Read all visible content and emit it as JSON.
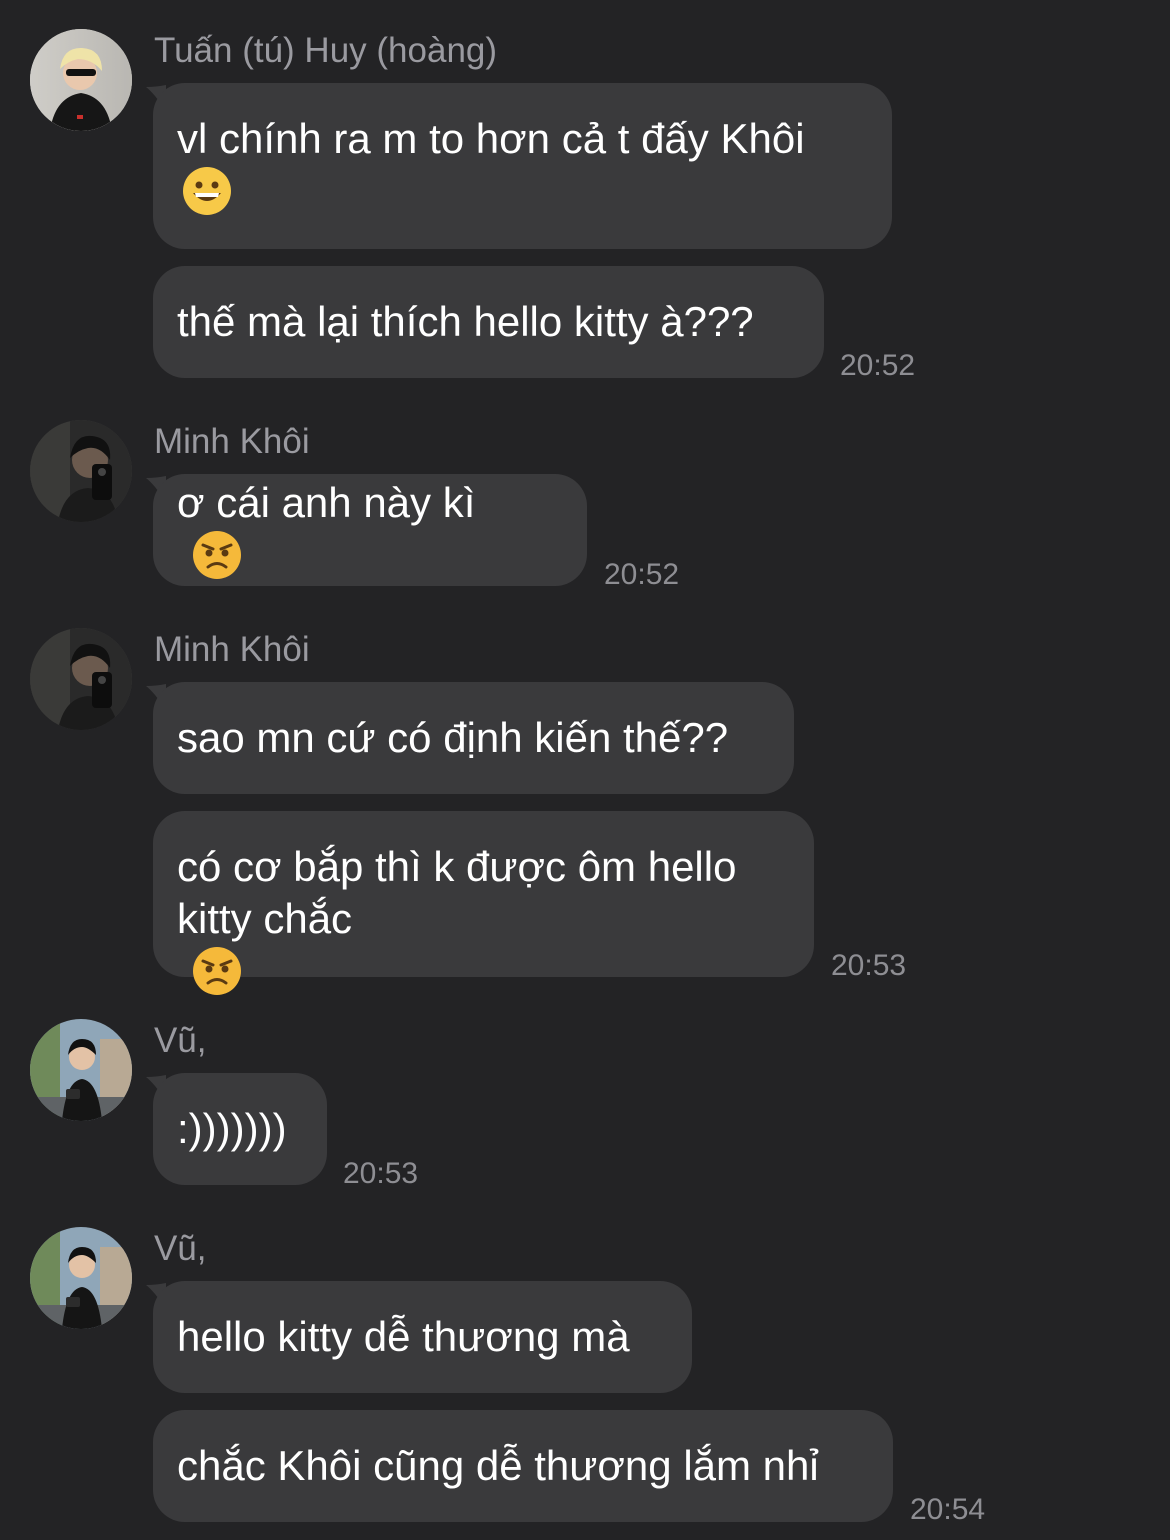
{
  "messages": [
    {
      "sender": "Tuấn (tú) Huy (hoàng)",
      "avatar": "avatar-huy",
      "bubbles": [
        {
          "text": "vl chính ra m to hơn cả t đấy Khôi",
          "emoji": "grinning-face-icon"
        },
        {
          "text": "thế mà lại thích hello kitty à???"
        }
      ],
      "time": "20:52"
    },
    {
      "sender": "Minh Khôi",
      "avatar": "avatar-khoi",
      "bubbles": [
        {
          "text": "ơ cái anh này kì",
          "emoji": "angry-face-icon"
        }
      ],
      "time": "20:52"
    },
    {
      "sender": "Minh Khôi",
      "avatar": "avatar-khoi",
      "bubbles": [
        {
          "text": "sao mn cứ có định kiến thế??"
        },
        {
          "text": "có cơ bắp thì k được ôm hello kitty chắc",
          "emoji": "angry-face-icon"
        }
      ],
      "time": "20:53"
    },
    {
      "sender": "Vũ,",
      "avatar": "avatar-vu",
      "bubbles": [
        {
          "text": ":)))))))"
        }
      ],
      "time": "20:53"
    },
    {
      "sender": "Vũ,",
      "avatar": "avatar-vu",
      "bubbles": [
        {
          "text": "hello kitty dễ thương mà"
        },
        {
          "text": "chắc Khôi cũng dễ thương lắm nhỉ"
        }
      ],
      "time": "20:54"
    }
  ],
  "colors": {
    "background": "#232325",
    "bubble": "#3a3a3c",
    "text": "#ffffff",
    "sender": "#9a9aa0",
    "time": "#8e8e93"
  }
}
